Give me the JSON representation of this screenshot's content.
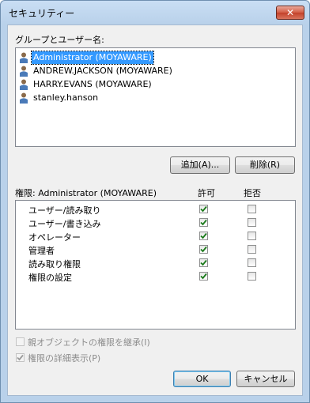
{
  "window": {
    "title": "セキュリティー",
    "close_glyph": "✕"
  },
  "groups_label": "グループとユーザー名:",
  "users": [
    {
      "name": "Administrator (MOYAWARE)",
      "selected": true
    },
    {
      "name": "ANDREW.JACKSON (MOYAWARE)",
      "selected": false
    },
    {
      "name": "HARRY.EVANS (MOYAWARE)",
      "selected": false
    },
    {
      "name": "stanley.hanson",
      "selected": false
    }
  ],
  "buttons": {
    "add": "追加(A)...",
    "remove": "削除(R)",
    "ok": "OK",
    "cancel": "キャンセル"
  },
  "permissions": {
    "header": "権限: Administrator (MOYAWARE)",
    "allow_header": "許可",
    "deny_header": "拒否",
    "rows": [
      {
        "name": "ユーザー/読み取り",
        "allow": true,
        "deny": false
      },
      {
        "name": "ユーザー/書き込み",
        "allow": true,
        "deny": false
      },
      {
        "name": "オペレーター",
        "allow": true,
        "deny": false
      },
      {
        "name": "管理者",
        "allow": true,
        "deny": false
      },
      {
        "name": "読み取り権限",
        "allow": true,
        "deny": false
      },
      {
        "name": "権限の設定",
        "allow": true,
        "deny": false
      }
    ]
  },
  "options": {
    "inherit": {
      "label": "親オブジェクトの権限を継承(I)",
      "checked": false,
      "enabled": false
    },
    "details": {
      "label": "権限の詳細表示(P)",
      "checked": true,
      "enabled": false
    }
  },
  "colors": {
    "check": "#1a7a1a",
    "selection": "#3399ff"
  }
}
